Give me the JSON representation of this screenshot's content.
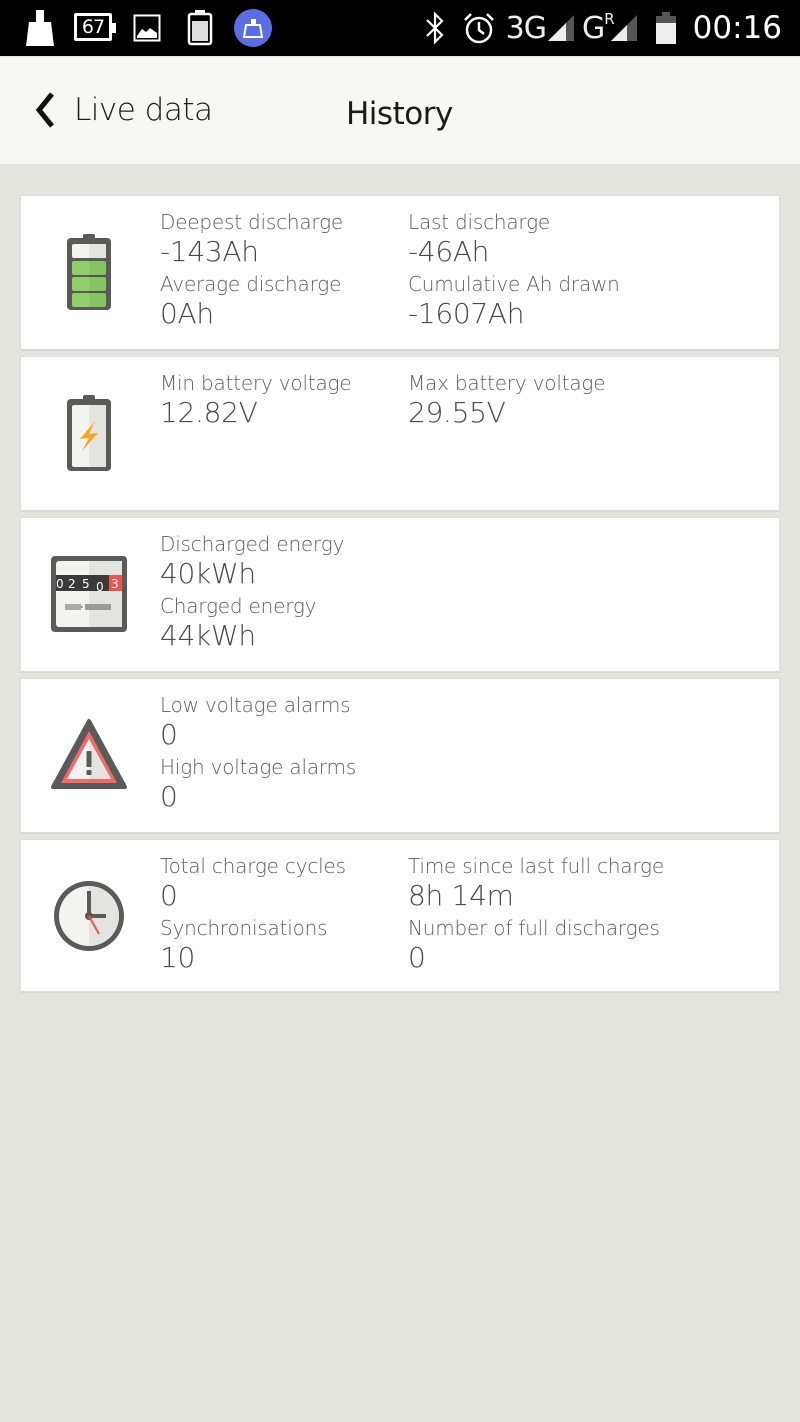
{
  "status_bar": {
    "left_icons": [
      "cleaner-icon",
      "battery-percent-icon",
      "image-icon",
      "battery-full-icon",
      "cleaner-active-icon"
    ],
    "battery_percent": "67",
    "network_1": "3G",
    "network_2": "G",
    "network_2_roaming": "R",
    "time": "00:16",
    "colors": {
      "background": "#000000",
      "active_badge": "#5b6ee1"
    }
  },
  "header": {
    "back_label": "Live data",
    "title": "History"
  },
  "cards": [
    {
      "icon": "battery-level-icon",
      "fields": [
        {
          "label": "Deepest discharge",
          "value": "-143Ah"
        },
        {
          "label": "Last discharge",
          "value": "-46Ah"
        },
        {
          "label": "Average discharge",
          "value": "0Ah"
        },
        {
          "label": "Cumulative Ah drawn",
          "value": "-1607Ah"
        }
      ]
    },
    {
      "icon": "battery-voltage-icon",
      "fields": [
        {
          "label": "Min battery voltage",
          "value": "12.82V"
        },
        {
          "label": "Max battery voltage",
          "value": "29.55V"
        }
      ]
    },
    {
      "icon": "energy-meter-icon",
      "meter_digits": [
        "0",
        "2",
        "5",
        "0",
        "3"
      ],
      "fields": [
        {
          "label": "Discharged energy",
          "value": "40kWh"
        },
        {
          "label": "Charged energy",
          "value": "44kWh"
        }
      ]
    },
    {
      "icon": "warning-icon",
      "fields": [
        {
          "label": "Low voltage alarms",
          "value": "0"
        },
        {
          "label": "High voltage alarms",
          "value": "0"
        }
      ]
    },
    {
      "icon": "clock-icon",
      "fields": [
        {
          "label": "Total charge cycles",
          "value": "0"
        },
        {
          "label": "Time since last full charge",
          "value": "8h 14m"
        },
        {
          "label": "Synchronisations",
          "value": "10"
        },
        {
          "label": "Number of full discharges",
          "value": "0"
        }
      ]
    }
  ],
  "colors": {
    "page_background": "#e4e4df",
    "header_background": "#f6f6f2",
    "card_background": "#ffffff",
    "icon_dark": "#5a5a58",
    "battery_green": "#8cc864",
    "bolt_orange": "#f5a623",
    "alert_red": "#ef5350"
  }
}
